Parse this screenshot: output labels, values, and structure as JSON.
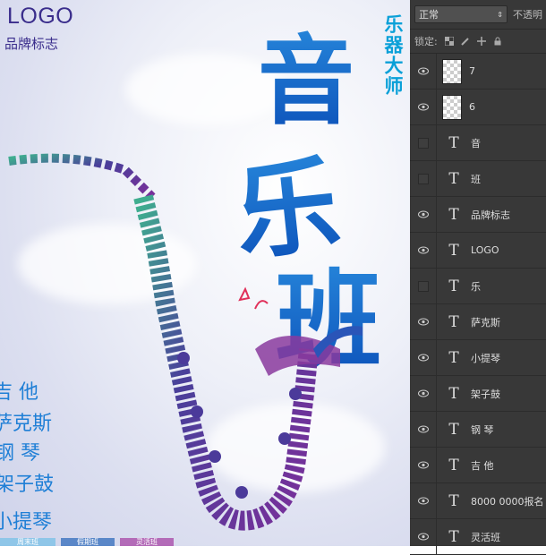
{
  "poster": {
    "logo": "LOGO",
    "brand": "品牌标志",
    "title_chars": [
      "音",
      "乐",
      "班"
    ],
    "subtitle": "乐器大师",
    "courses": [
      "吉 他",
      "萨克斯",
      "钢 琴",
      "架子鼓",
      "小提琴"
    ],
    "bottom_tabs": [
      "周末班",
      "假期班",
      "灵活班"
    ],
    "colors": {
      "title": "#1a6fd0",
      "subtitle": "#0aa0d8",
      "course": "#1f7fd6",
      "logo": "#3a2d8c"
    }
  },
  "layers_panel": {
    "blend_mode": "正常",
    "opacity_label": "不透明",
    "lock_label": "锁定:",
    "layers": [
      {
        "name": "7",
        "kind": "image",
        "visible": true
      },
      {
        "name": "6",
        "kind": "image",
        "visible": true
      },
      {
        "name": "音",
        "kind": "text",
        "visible": false
      },
      {
        "name": "班",
        "kind": "text",
        "visible": false
      },
      {
        "name": "品牌标志",
        "kind": "text",
        "visible": true
      },
      {
        "name": "LOGO",
        "kind": "text",
        "visible": true
      },
      {
        "name": "乐",
        "kind": "text",
        "visible": false
      },
      {
        "name": "萨克斯",
        "kind": "text",
        "visible": true
      },
      {
        "name": "小提琴",
        "kind": "text",
        "visible": true
      },
      {
        "name": "架子鼓",
        "kind": "text",
        "visible": true
      },
      {
        "name": "钢 琴",
        "kind": "text",
        "visible": true
      },
      {
        "name": "吉 他",
        "kind": "text",
        "visible": true
      },
      {
        "name": "8000 0000报名",
        "kind": "text",
        "visible": true
      },
      {
        "name": "灵活班",
        "kind": "text",
        "visible": true
      }
    ]
  }
}
